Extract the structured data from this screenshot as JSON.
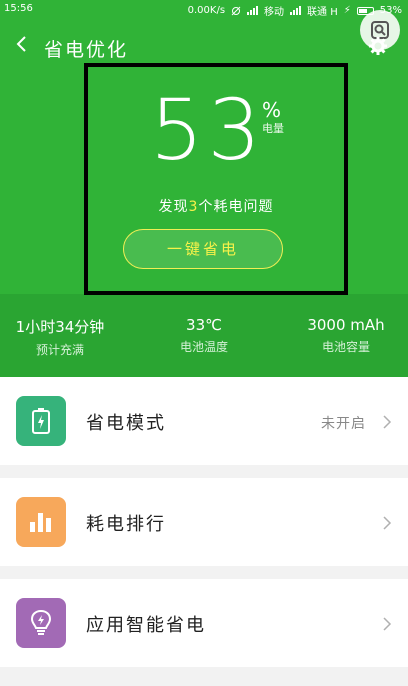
{
  "status_bar": {
    "time": "15:56",
    "speed": "0.00K/s",
    "carrier1": "移动",
    "carrier2": "联通 H",
    "battery": "53%"
  },
  "header": {
    "title": "省电优化"
  },
  "battery": {
    "percent": "53",
    "percent_sign": "%",
    "label": "电量",
    "found_prefix": "发现",
    "issue_count": "3",
    "found_suffix": "个耗电问题",
    "optimize_button": "一键省电"
  },
  "stats": [
    {
      "value": "1小时34分钟",
      "label": "预计充满"
    },
    {
      "value": "33℃",
      "label": "电池温度"
    },
    {
      "value": "3000 mAh",
      "label": "电池容量"
    }
  ],
  "menu": [
    {
      "label": "省电模式",
      "status": "未开启",
      "icon": "battery-bolt-icon",
      "color": "#36b37b"
    },
    {
      "label": "耗电排行",
      "status": "",
      "icon": "bar-chart-icon",
      "color": "#f7a85b"
    },
    {
      "label": "应用智能省电",
      "status": "",
      "icon": "bulb-icon",
      "color": "#a26ab5"
    }
  ]
}
